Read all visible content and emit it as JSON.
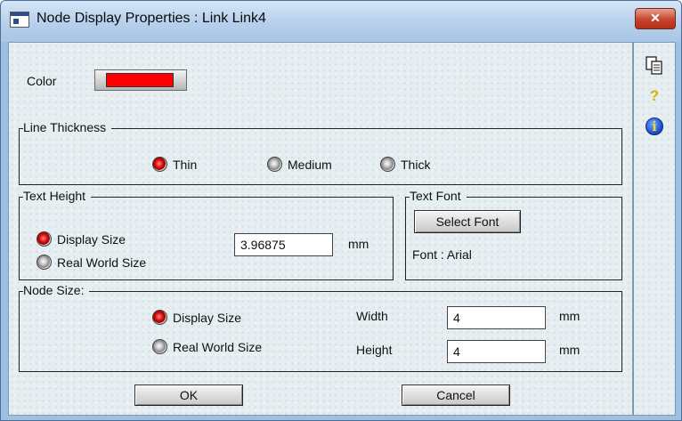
{
  "window": {
    "title": "Node Display Properties : Link Link4",
    "close_glyph": "✕"
  },
  "colors": {
    "link_color": "#ff0000",
    "selected_radio": "#e01010"
  },
  "color_row": {
    "label": "Color"
  },
  "line_thickness": {
    "legend": "Line Thickness",
    "options": [
      {
        "label": "Thin",
        "selected": true
      },
      {
        "label": "Medium",
        "selected": false
      },
      {
        "label": "Thick",
        "selected": false
      }
    ]
  },
  "text_height": {
    "legend": "Text Height",
    "options": [
      {
        "label": "Display Size",
        "selected": true
      },
      {
        "label": "Real World Size",
        "selected": false
      }
    ],
    "value": "3.96875",
    "unit": "mm"
  },
  "text_font": {
    "legend": "Text Font",
    "button_label": "Select Font",
    "font_info": "Font : Arial"
  },
  "node_size": {
    "legend": "Node Size:",
    "options": [
      {
        "label": "Display Size",
        "selected": true
      },
      {
        "label": "Real World Size",
        "selected": false
      }
    ],
    "width_label": "Width",
    "width_value": "4",
    "height_label": "Height",
    "height_value": "4",
    "unit": "mm"
  },
  "buttons": {
    "ok": "OK",
    "cancel": "Cancel"
  },
  "side_toolbar": {
    "icons": [
      "copy-icon",
      "help-icon",
      "info-icon"
    ],
    "help_glyph": "?",
    "info_glyph": "i"
  }
}
